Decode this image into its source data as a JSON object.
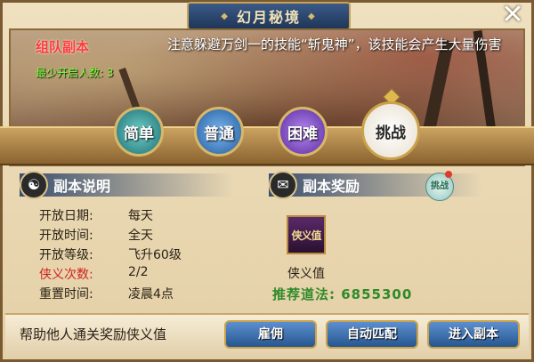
{
  "window": {
    "title": "幻月秘境",
    "close_symbol": "✕"
  },
  "scene": {
    "mode_label": "组队副本",
    "min_players": "最少开启人数: 3",
    "tip": "注意躲避万剑一的技能“斩鬼神”，该技能会产生大量伤害"
  },
  "difficulties": [
    {
      "label": "简单",
      "selected": false
    },
    {
      "label": "普通",
      "selected": false
    },
    {
      "label": "困难",
      "selected": false
    },
    {
      "label": "挑战",
      "selected": true
    }
  ],
  "description": {
    "header": "副本说明",
    "icon": "yin-yang-icon",
    "rows": [
      {
        "key": "开放日期:",
        "value": "每天",
        "highlight": false
      },
      {
        "key": "开放时间:",
        "value": "全天",
        "highlight": false
      },
      {
        "key": "开放等级:",
        "value": "飞升60级",
        "highlight": false
      },
      {
        "key": "侠义次数:",
        "value": "2/2",
        "highlight": true
      },
      {
        "key": "重置时间:",
        "value": "凌晨4点",
        "highlight": false
      }
    ]
  },
  "rewards": {
    "header": "副本奖励",
    "icon": "scroll-icon",
    "badge": "挑战",
    "item_label": "侠义值",
    "item_name": "侠义值",
    "recommend": "推荐道法: 6855300"
  },
  "footer": {
    "help_text": "帮助他人通关奖励侠义值",
    "hire_label": "雇佣",
    "auto_match_label": "自动匹配",
    "enter_label": "进入副本"
  },
  "colors": {
    "accent": "#26568f",
    "gold": "#c9a24a",
    "highlight_red": "#d02020",
    "recommend_green": "#2f8a2a"
  }
}
